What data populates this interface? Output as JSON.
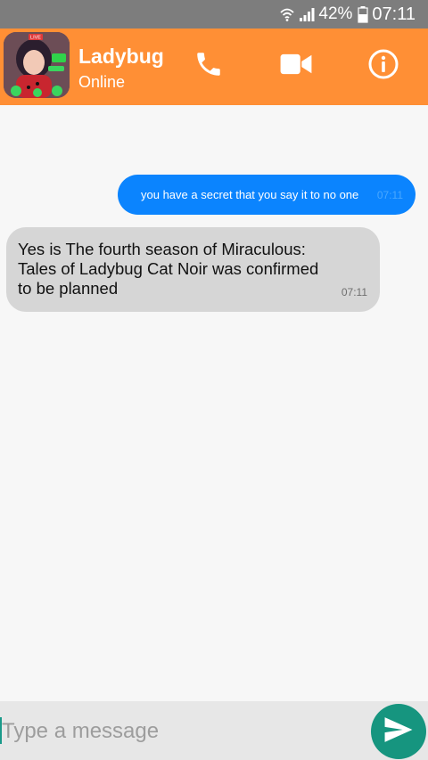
{
  "status_bar": {
    "icons": [
      "wifi-icon",
      "signal-icon",
      "battery-icon"
    ],
    "battery": "42%",
    "time": "07:11"
  },
  "header": {
    "contact_name": "Ladybug",
    "contact_status": "Online",
    "avatar_badge": "LIVE",
    "actions": [
      "phone-icon",
      "video-camera-icon",
      "info-icon"
    ],
    "color": "#ff8f35"
  },
  "messages": [
    {
      "direction": "outgoing",
      "text": "you have a secret that you say it to no one",
      "time": "07:11",
      "color": "#0b84fe"
    },
    {
      "direction": "incoming",
      "text": "Yes is The fourth season of Miraculous:\nTales of Ladybug Cat Noir was confirmed\nto be planned",
      "time": "07:11",
      "color": "#d6d6d6"
    }
  ],
  "composer": {
    "placeholder": "Type a message",
    "value": "",
    "send_icon": "send-icon",
    "send_color": "#16957f"
  }
}
